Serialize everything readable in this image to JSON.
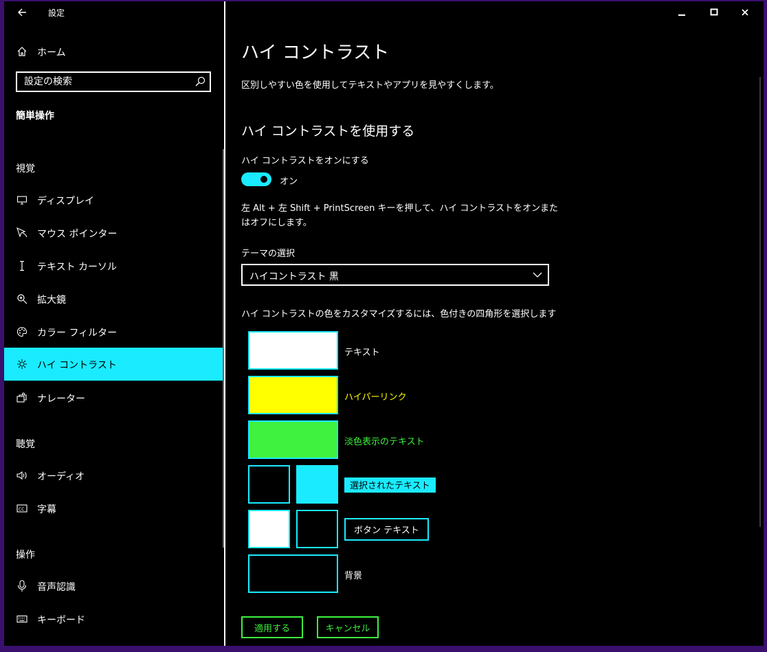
{
  "window": {
    "app_title": "設定",
    "back_icon": "back-arrow-icon",
    "controls": [
      "minimize-icon",
      "maximize-icon",
      "close-icon"
    ]
  },
  "sidebar": {
    "home_label": "ホーム",
    "search_placeholder": "設定の検索",
    "section_title": "簡単操作",
    "groups": [
      {
        "title": "視覚",
        "items": [
          {
            "label": "ディスプレイ",
            "icon": "display-icon"
          },
          {
            "label": "マウス ポインター",
            "icon": "mouse-pointer-icon"
          },
          {
            "label": "テキスト カーソル",
            "icon": "text-cursor-icon"
          },
          {
            "label": "拡大鏡",
            "icon": "magnifier-icon"
          },
          {
            "label": "カラー フィルター",
            "icon": "color-filter-icon"
          },
          {
            "label": "ハイ コントラスト",
            "icon": "high-contrast-icon",
            "selected": true
          },
          {
            "label": "ナレーター",
            "icon": "narrator-icon"
          }
        ]
      },
      {
        "title": "聴覚",
        "items": [
          {
            "label": "オーディオ",
            "icon": "audio-icon"
          },
          {
            "label": "字幕",
            "icon": "captions-icon"
          }
        ]
      },
      {
        "title": "操作",
        "items": [
          {
            "label": "音声認識",
            "icon": "microphone-icon"
          },
          {
            "label": "キーボード",
            "icon": "keyboard-icon"
          }
        ]
      }
    ]
  },
  "main": {
    "title": "ハイ コントラスト",
    "description": "区別しやすい色を使用してテキストやアプリを見やすくします。",
    "subtitle": "ハイ コントラストを使用する",
    "toggle_label": "ハイ コントラストをオンにする",
    "toggle_state": "オン",
    "toggle_on": true,
    "shortcut_hint": "左 Alt + 左 Shift + PrintScreen キーを押して、ハイ コントラストをオンまたはオフにします。",
    "theme_label": "テーマの選択",
    "theme_value": "ハイコントラスト 黒",
    "customize_hint": "ハイ コントラストの色をカスタマイズするには、色付きの四角形を選択します",
    "swatches": {
      "text": {
        "label": "テキスト",
        "color": "#ffffff"
      },
      "hyperlink": {
        "label": "ハイパーリンク",
        "color": "#ffff00"
      },
      "disabled_text": {
        "label": "淡色表示のテキスト",
        "color": "#3ff23f"
      },
      "selected_text": {
        "label": "選択されたテキスト",
        "fg": "#000000",
        "bg": "#1aebff"
      },
      "button_text": {
        "label": "ボタン テキスト",
        "fg": "#ffffff",
        "bg": "#000000"
      },
      "background": {
        "label": "背景",
        "color": "#000000"
      }
    },
    "apply_label": "適用する",
    "cancel_label": "キャンセル"
  },
  "colors": {
    "accent": "#1aebff",
    "hyperlink": "#ffff00",
    "disabled": "#3ff23f",
    "background": "#000000",
    "frame": "#3a0f6e"
  }
}
